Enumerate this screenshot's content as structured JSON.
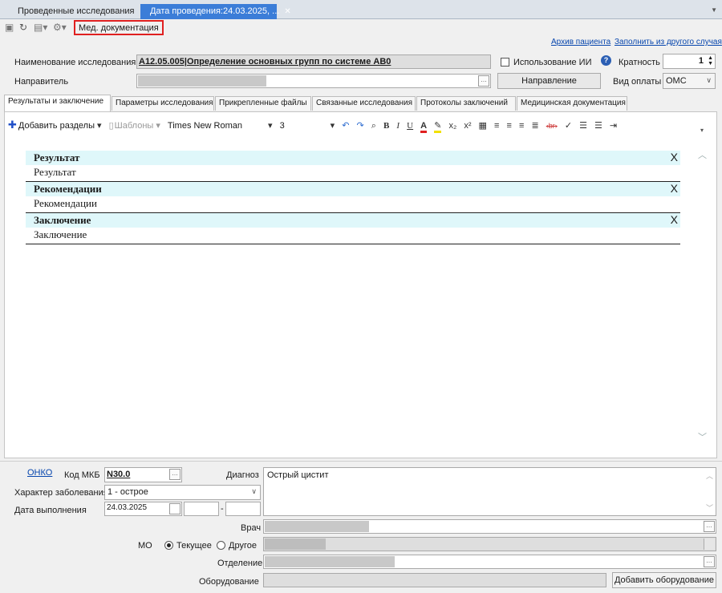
{
  "tabs": [
    {
      "label": "Проведенные исследования"
    },
    {
      "label": "Дата проведения:24.03.2025, ..."
    }
  ],
  "toolbar": {
    "med_doc_label": "Мед. документация"
  },
  "links": {
    "archive": "Архив пациента",
    "fill_other": "Заполнить из другого случая"
  },
  "form": {
    "study_name_label": "Наименование исследования",
    "study_name_value": "A12.05.005|Определение основных групп по системе AB0",
    "ai_usage_label": "Использование ИИ",
    "multiplicity_label": "Кратность",
    "multiplicity_value": "1",
    "referrer_label": "Направитель",
    "direction_button": "Направление",
    "payment_label": "Вид оплаты",
    "payment_value": "ОМС"
  },
  "inner_tabs": [
    "Результаты и заключение",
    "Параметры исследования",
    "Прикрепленные файлы",
    "Связанные исследования",
    "Протоколы заключений",
    "Медицинская документация"
  ],
  "editor_toolbar": {
    "add_sections": "Добавить разделы",
    "templates": "Шаблоны",
    "font_name": "Times New Roman",
    "font_size": "3"
  },
  "sections": [
    {
      "title": "Результат",
      "body": "Результат",
      "remove": "X"
    },
    {
      "title": "Рекомендации",
      "body": "Рекомендации",
      "remove": "X"
    },
    {
      "title": "Заключение",
      "body": "Заключение",
      "remove": "X"
    }
  ],
  "bottom": {
    "onko_link": "ОНКО",
    "mkb_label": "Код МКБ",
    "mkb_value": "N30.0",
    "diagnosis_label": "Диагноз",
    "diagnosis_value": "Острый цистит",
    "disease_char_label": "Характер заболевания",
    "disease_char_value": "1 - острое",
    "exec_date_label": "Дата выполнения",
    "exec_date_value": "24.03.2025",
    "doctor_label": "Врач",
    "mo_label": "МО",
    "mo_current": "Текущее",
    "mo_other": "Другое",
    "department_label": "Отделение",
    "equipment_label": "Оборудование",
    "add_equipment_button": "Добавить оборудование"
  }
}
